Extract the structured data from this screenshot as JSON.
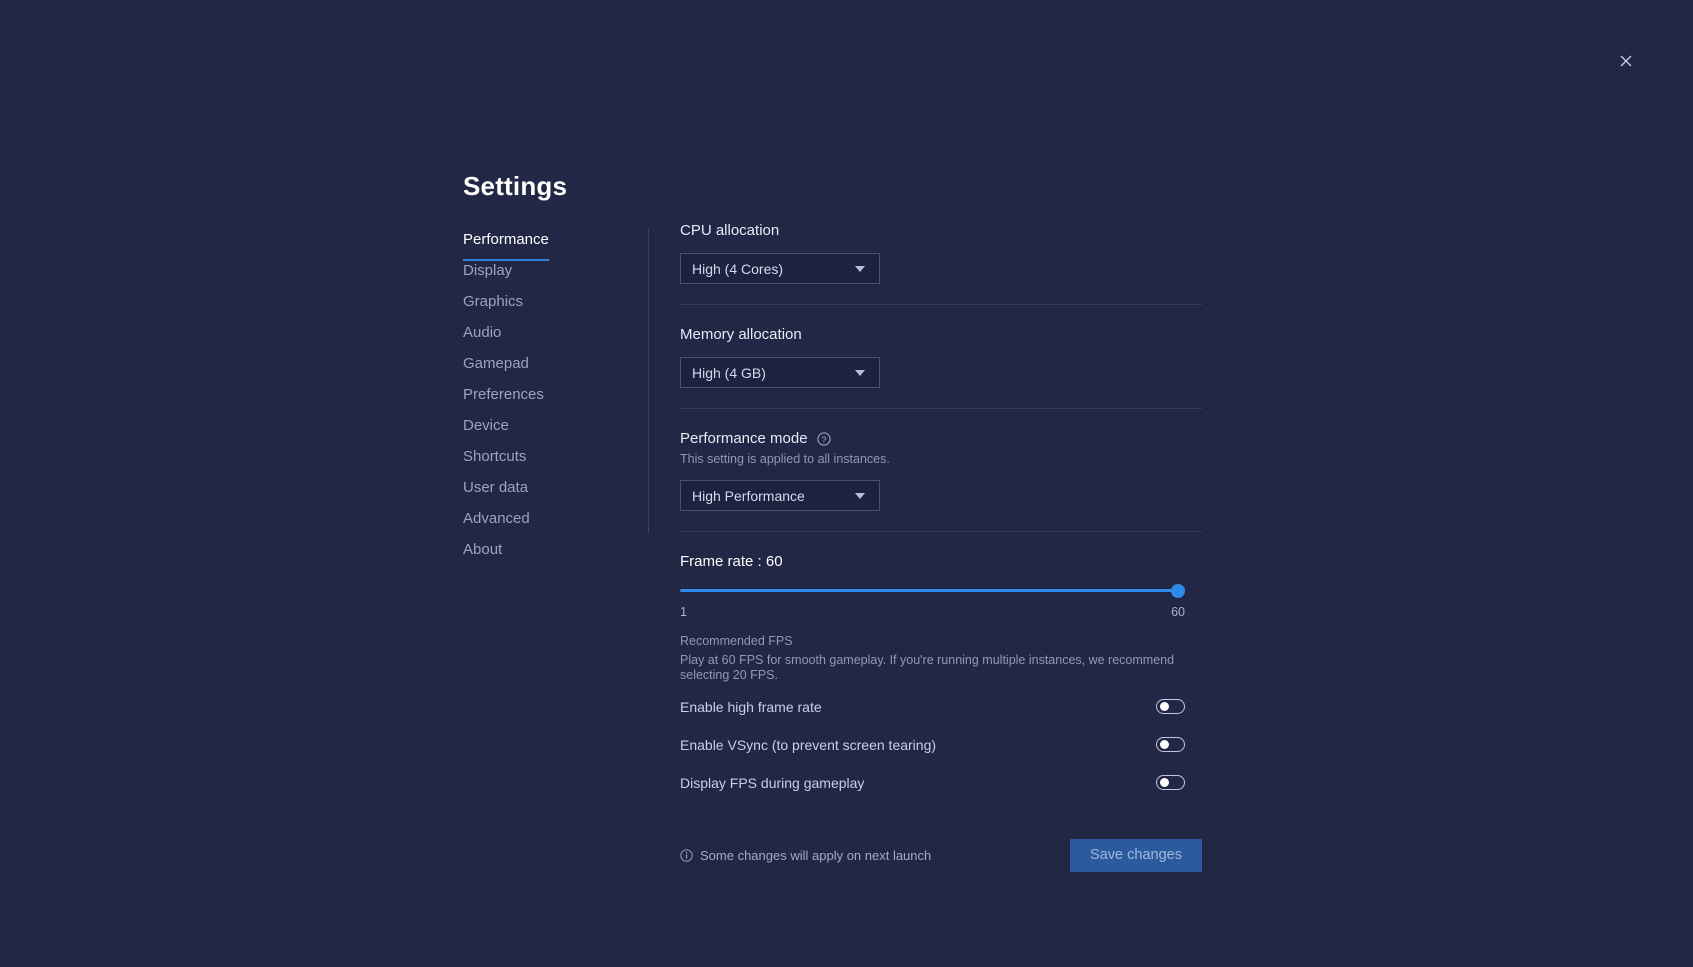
{
  "window": {
    "close_icon": "close-icon"
  },
  "header": {
    "title": "Settings"
  },
  "sidebar": {
    "items": [
      {
        "label": "Performance",
        "active": true
      },
      {
        "label": "Display",
        "active": false
      },
      {
        "label": "Graphics",
        "active": false
      },
      {
        "label": "Audio",
        "active": false
      },
      {
        "label": "Gamepad",
        "active": false
      },
      {
        "label": "Preferences",
        "active": false
      },
      {
        "label": "Device",
        "active": false
      },
      {
        "label": "Shortcuts",
        "active": false
      },
      {
        "label": "User data",
        "active": false
      },
      {
        "label": "Advanced",
        "active": false
      },
      {
        "label": "About",
        "active": false
      }
    ]
  },
  "main": {
    "cpu": {
      "label": "CPU allocation",
      "value": "High (4 Cores)"
    },
    "memory": {
      "label": "Memory allocation",
      "value": "High (4 GB)"
    },
    "performance_mode": {
      "label": "Performance mode",
      "help_icon": "help-circle-icon",
      "description": "This setting is applied to all instances.",
      "value": "High Performance"
    },
    "frame_rate": {
      "title": "Frame rate : 60",
      "value": 60,
      "min": 1,
      "max": 60,
      "min_label": "1",
      "max_label": "60",
      "recommended_title": "Recommended FPS",
      "recommended_body": "Play at 60 FPS for smooth gameplay. If you're running multiple instances, we recommend selecting 20 FPS."
    },
    "toggles": [
      {
        "label": "Enable high frame rate",
        "on": false
      },
      {
        "label": "Enable VSync (to prevent screen tearing)",
        "on": false
      },
      {
        "label": "Display FPS during gameplay",
        "on": false
      }
    ],
    "footer": {
      "info_icon": "info-circle-icon",
      "status_text": "Some changes will apply on next launch",
      "save_label": "Save changes"
    }
  },
  "colors": {
    "background": "#222745",
    "accent": "#2f8ae8",
    "save_button": "#2b5b9e",
    "divider": "#353b5e"
  }
}
